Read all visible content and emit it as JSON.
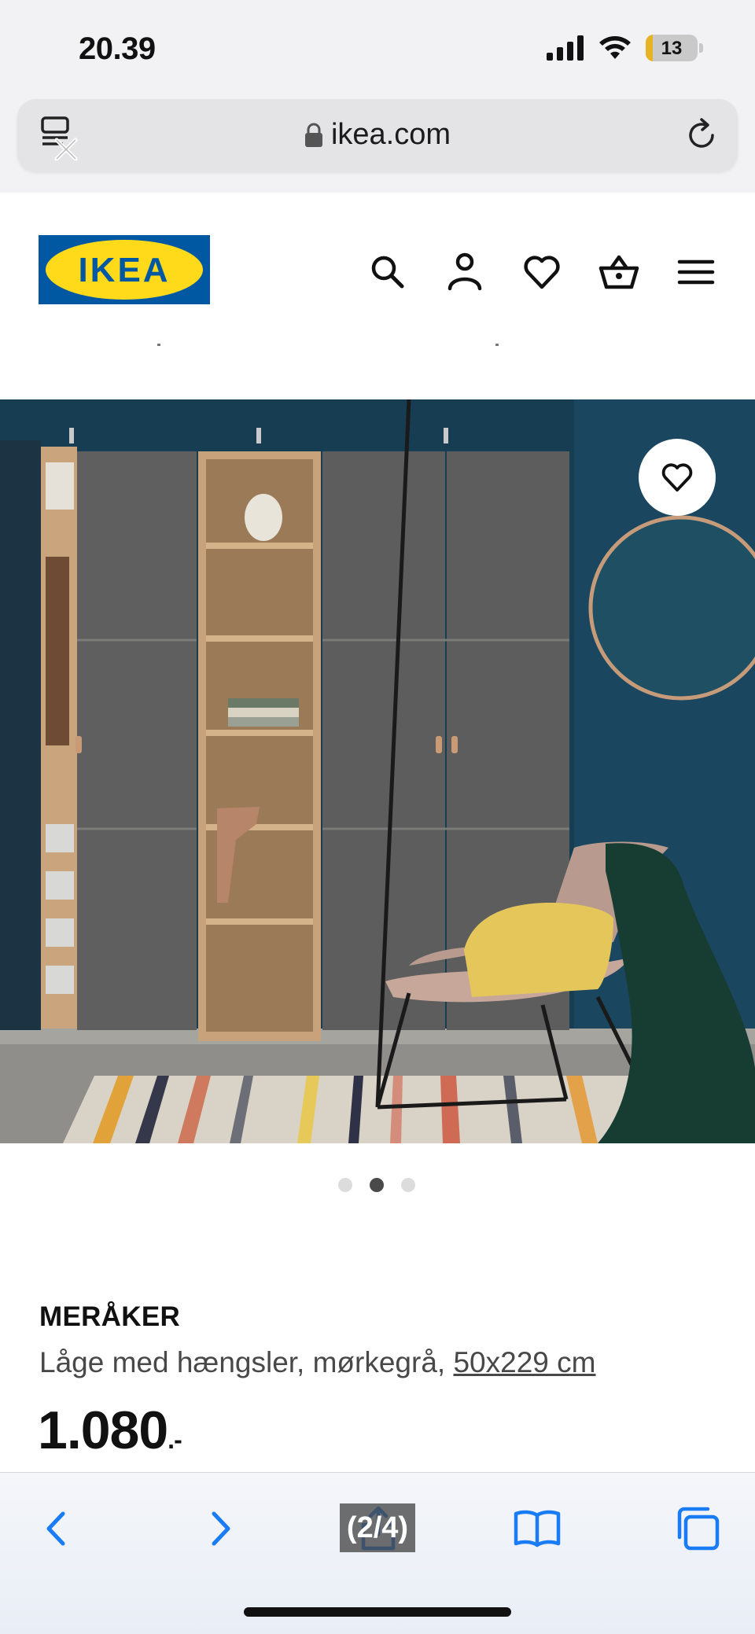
{
  "status_bar": {
    "time": "20.39",
    "battery_level": "13",
    "battery_fraction": 0.13
  },
  "browser": {
    "url": "ikea.com"
  },
  "header": {
    "logo_text": "IKEA",
    "logo_colors": {
      "blue": "#0058a3",
      "yellow": "#ffda1a"
    },
    "icons": [
      "search-icon",
      "user-icon",
      "heart-icon",
      "basket-icon",
      "menu-icon"
    ]
  },
  "gallery": {
    "current_index": 2,
    "total": 3
  },
  "product": {
    "name": "MERÅKER",
    "description": "Låge med hængsler, mørkegrå, ",
    "size": "50x229 cm",
    "price": "1.080",
    "price_suffix": ".-"
  },
  "toolbar": {
    "icons": [
      "back-icon",
      "forward-icon",
      "share-icon",
      "bookmarks-icon",
      "tabs-icon"
    ],
    "accent_color": "#1a7cf5"
  },
  "overlay": {
    "page_counter": "(2/4)"
  }
}
